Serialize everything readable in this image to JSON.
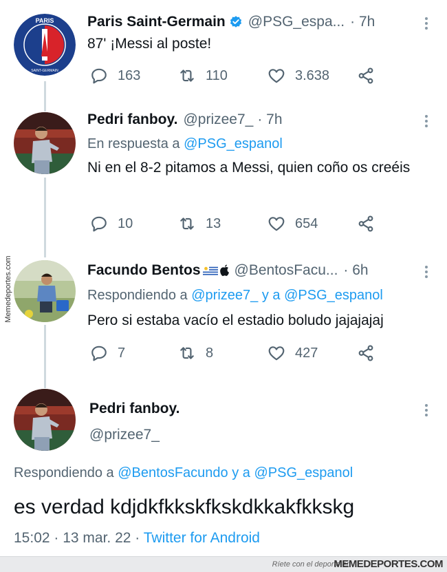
{
  "tweets": [
    {
      "author_name": "Paris Saint-Germain",
      "handle": "@PSG_espa...",
      "time": "· 7h",
      "text": "87' ¡Messi al poste!",
      "replies": "163",
      "retweets": "110",
      "likes": "3.638",
      "logo_text_top": "PARIS",
      "logo_text_bottom": "SAINT-GERMAIN"
    },
    {
      "author_name": "Pedri fanboy.",
      "handle": "@prizee7_",
      "time": "· 7h",
      "reply_prefix": "En respuesta a",
      "reply_mention_1": "@PSG_espanol",
      "text": "Ni en el 8-2 pitamos a Messi, quien coño os creéis",
      "replies": "10",
      "retweets": "13",
      "likes": "654"
    },
    {
      "author_name": "Facundo Bentos",
      "handle": "@BentosFacu...",
      "time": "· 6h",
      "reply_prefix": "Respondiendo a",
      "reply_mention_1": "@prizee7_",
      "reply_joiner": "y a",
      "reply_mention_2": "@PSG_espanol",
      "text": "Pero si estaba vacío el estadio boludo jajajajaj",
      "replies": "7",
      "retweets": "8",
      "likes": "427"
    }
  ],
  "main_tweet": {
    "author_name": "Pedri fanboy.",
    "handle": "@prizee7_",
    "reply_prefix": "Respondiendo a",
    "reply_mention_1": "@BentosFacundo",
    "reply_joiner": "y a",
    "reply_mention_2": "@PSG_espanol",
    "text": "es verdad kdjdkfkkskfkskdkkakfkkskg",
    "timestamp": "15:02 · 13 mar. 22 ·",
    "source": "Twitter for Android"
  },
  "watermark": {
    "side": "Memedeportes.com",
    "footer_left": "Ríete con el deporte en",
    "footer_right": "MEMEDEPORTES.COM"
  },
  "colors": {
    "link": "#1d9bf0",
    "secondary": "#536471",
    "verified": "#1d9bf0",
    "psg_blue": "#1c3f8c",
    "psg_red": "#d8232a"
  },
  "icons": [
    "verified-badge-icon",
    "more-options-icon",
    "reply-icon",
    "retweet-icon",
    "like-icon",
    "share-icon",
    "uruguay-flag-icon",
    "apple-logo-icon"
  ]
}
